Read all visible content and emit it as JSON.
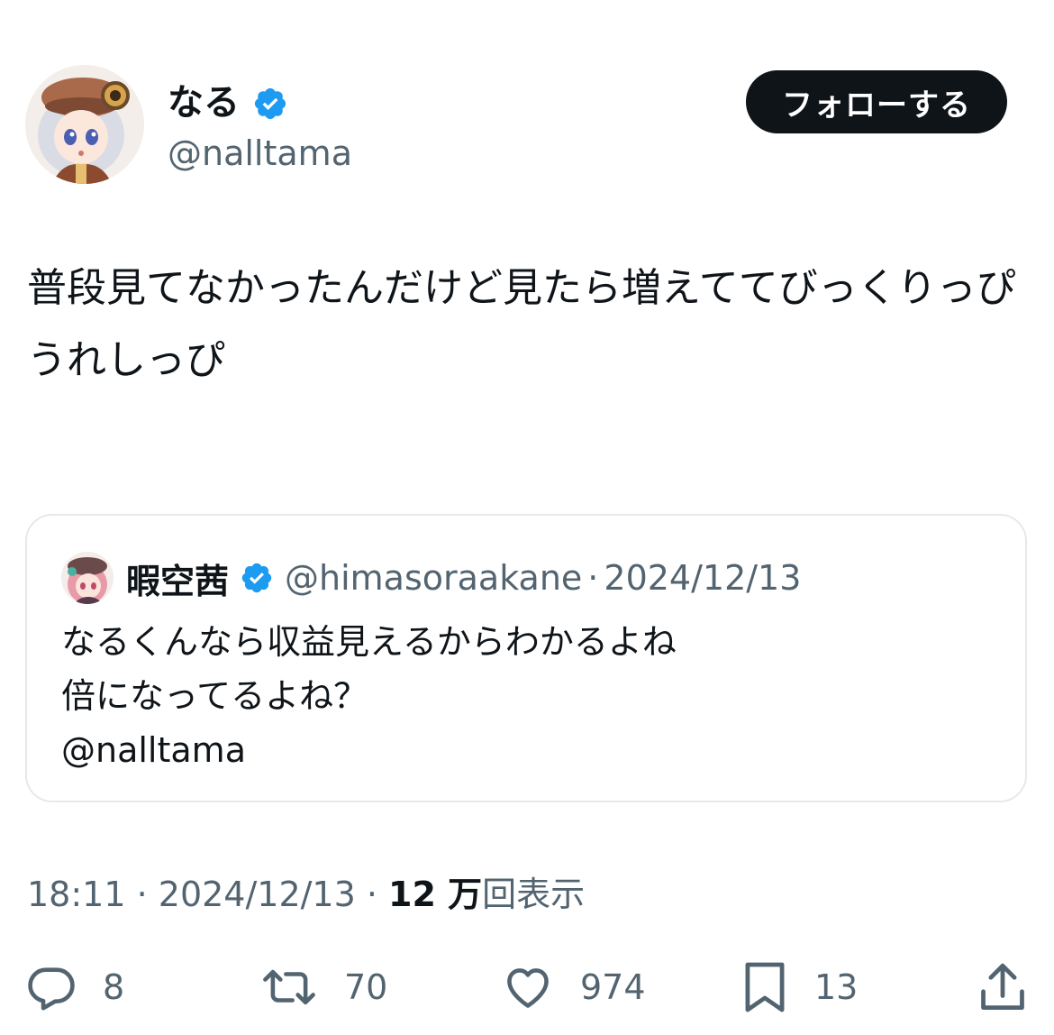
{
  "author": {
    "display_name": "なる",
    "handle": "@nalltama",
    "avatar_icon": "avatar-anime-girl-icon",
    "verified_icon": "verified-badge-icon"
  },
  "follow_button": {
    "label": "フォローする"
  },
  "tweet": {
    "text": "普段見てなかったんだけど見たら増えててびっくりっぴ\nうれしっぴ"
  },
  "quote": {
    "display_name": "暇空茜",
    "handle": "@himasoraakane",
    "separator": "·",
    "date": "2024/12/13",
    "text": "なるくんなら収益見えるからわかるよね\n倍になってるよね？\n@nalltama"
  },
  "meta": {
    "time": "18:11",
    "sep1": " · ",
    "date": "2024/12/13",
    "sep2": " · ",
    "views_num": "12 万",
    "views_label": "回表示"
  },
  "actions": {
    "replies": "8",
    "reposts": "70",
    "likes": "974",
    "bookmarks": "13"
  },
  "colors": {
    "text_primary": "#0f1419",
    "text_secondary": "#536471",
    "verified_blue": "#1d9bf0",
    "border": "#e6e9ec"
  }
}
